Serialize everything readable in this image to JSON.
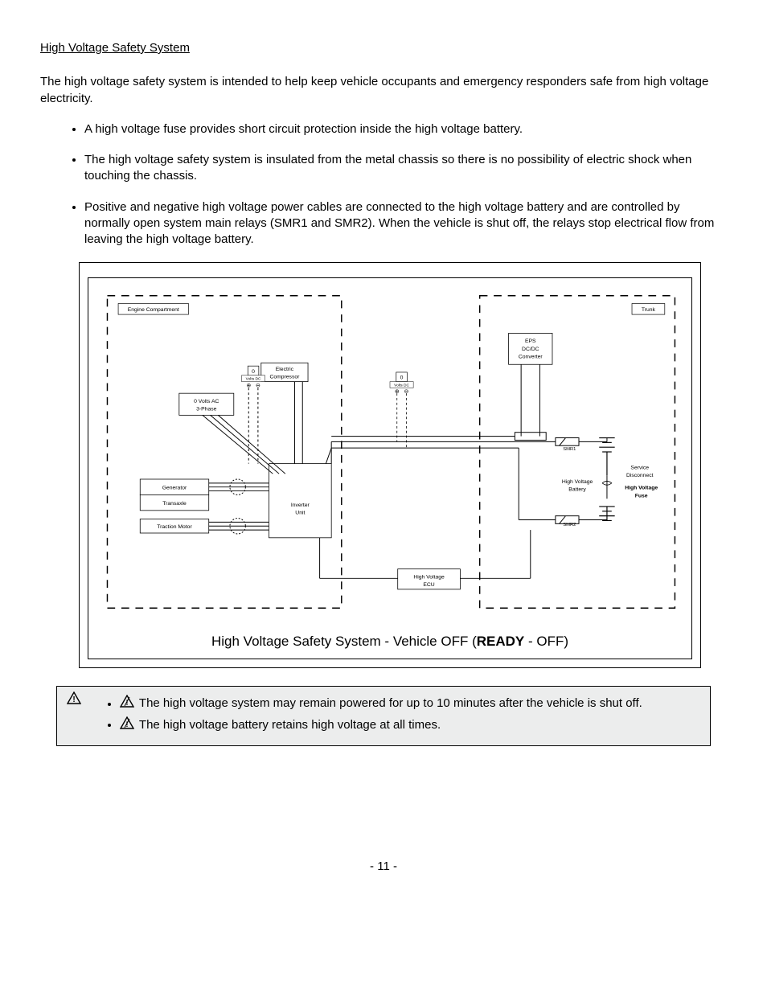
{
  "section_title": "High Voltage Safety System",
  "intro": "The high voltage safety system is intended to help keep vehicle occupants and emergency responders safe from high voltage electricity.",
  "bullets": [
    "A high voltage fuse provides short circuit protection inside the high voltage battery.",
    "The high voltage safety system is insulated from the metal chassis so there is no possibility of electric shock when touching the chassis.",
    "Positive and negative high voltage power cables are connected to the high voltage battery and are controlled by normally open system main relays (SMR1 and SMR2). When the vehicle is shut off, the relays stop electrical flow from leaving the high voltage battery."
  ],
  "caption_prefix": "High Voltage Safety System - Vehicle OFF (",
  "caption_bold": "READY",
  "caption_suffix": " - OFF)",
  "diagram": {
    "engine_compartment": "Engine Compartment",
    "trunk": "Trunk",
    "ac_3phase_l1": "0 Volts AC",
    "ac_3phase_l2": "3-Phase",
    "electric_l1": "Electric",
    "electric_l2": "Compressor",
    "zero": "0",
    "volts_dc": "Volts DC",
    "eps_l1": "EPS",
    "eps_l2": "DC/DC",
    "eps_l3": "Converter",
    "generator": "Generator",
    "transaxle": "Transaxle",
    "traction": "Traction Motor",
    "inverter_l1": "Inverter",
    "inverter_l2": "Unit",
    "hv_batt_l1": "High Voltage",
    "hv_batt_l2": "Battery",
    "service_l1": "Service",
    "service_l2": "Disconnect",
    "hv_fuse_l1": "High Voltage",
    "hv_fuse_l2": "Fuse",
    "hv_ecu_l1": "High Voltage",
    "hv_ecu_l2": "ECU",
    "smr1": "SMR1",
    "smr2": "SMR2",
    "plus": "⊕",
    "minus": "⊖"
  },
  "warnings": [
    "The high voltage system may remain powered for up to 10 minutes after the vehicle is shut off.",
    "The high voltage battery retains high voltage at all times."
  ],
  "page_num": "- 11 -"
}
